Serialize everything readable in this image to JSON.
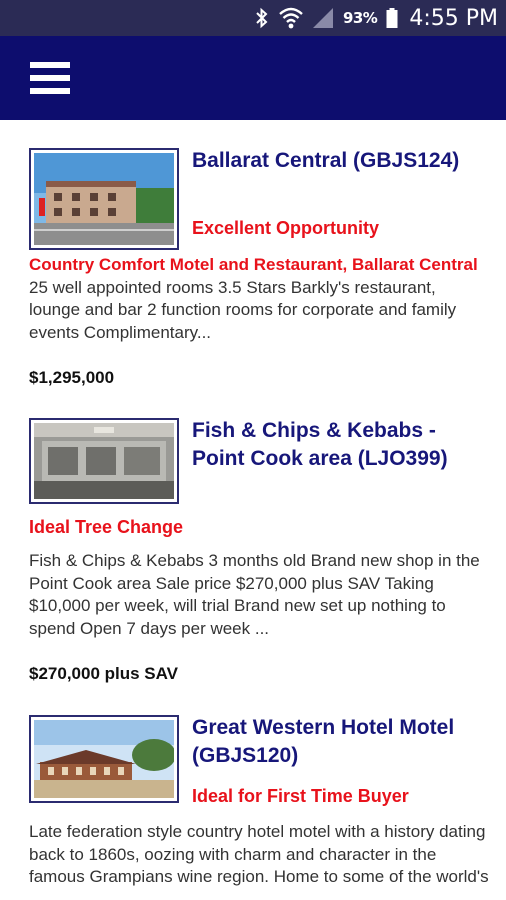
{
  "status_bar": {
    "battery_percent": "93%",
    "time": "4:55 PM",
    "icons": [
      "bluetooth-icon",
      "wifi-icon",
      "signal-icon",
      "battery-icon"
    ]
  },
  "app_bar": {
    "menu_icon": "hamburger-menu-icon",
    "color": "#0d0d6e"
  },
  "colors": {
    "title": "#17177a",
    "highlight": "#e8121b",
    "body_text": "#333333"
  },
  "listings": [
    {
      "title": "Ballarat Central (GBJS124)",
      "tag": "Excellent Opportunity",
      "description_highlight": "Country Comfort Motel and Restaurant, Ballarat Central",
      "description": " 25 well appointed rooms 3.5 Stars Barkly's restaurant, lounge and bar 2 function rooms for corporate and family events Complimentary...",
      "price": "$1,295,000"
    },
    {
      "title": "Fish & Chips & Kebabs - Point Cook area (LJO399)",
      "tag": "Ideal Tree Change",
      "description_highlight": "",
      "description": "Fish & Chips & Kebabs 3 months old Brand new shop in the Point Cook area Sale price $270,000 plus SAV Taking $10,000 per week, will trial Brand new set up nothing to spend Open 7 days per week ...",
      "price": "$270,000 plus SAV"
    },
    {
      "title": "Great Western Hotel Motel (GBJS120)",
      "tag": "Ideal for First Time Buyer",
      "description_highlight": "",
      "description": "Late federation style country hotel motel with a history dating back to 1860s, oozing with charm and character in the famous Grampians wine region. Home to some of the world's",
      "price": ""
    }
  ]
}
